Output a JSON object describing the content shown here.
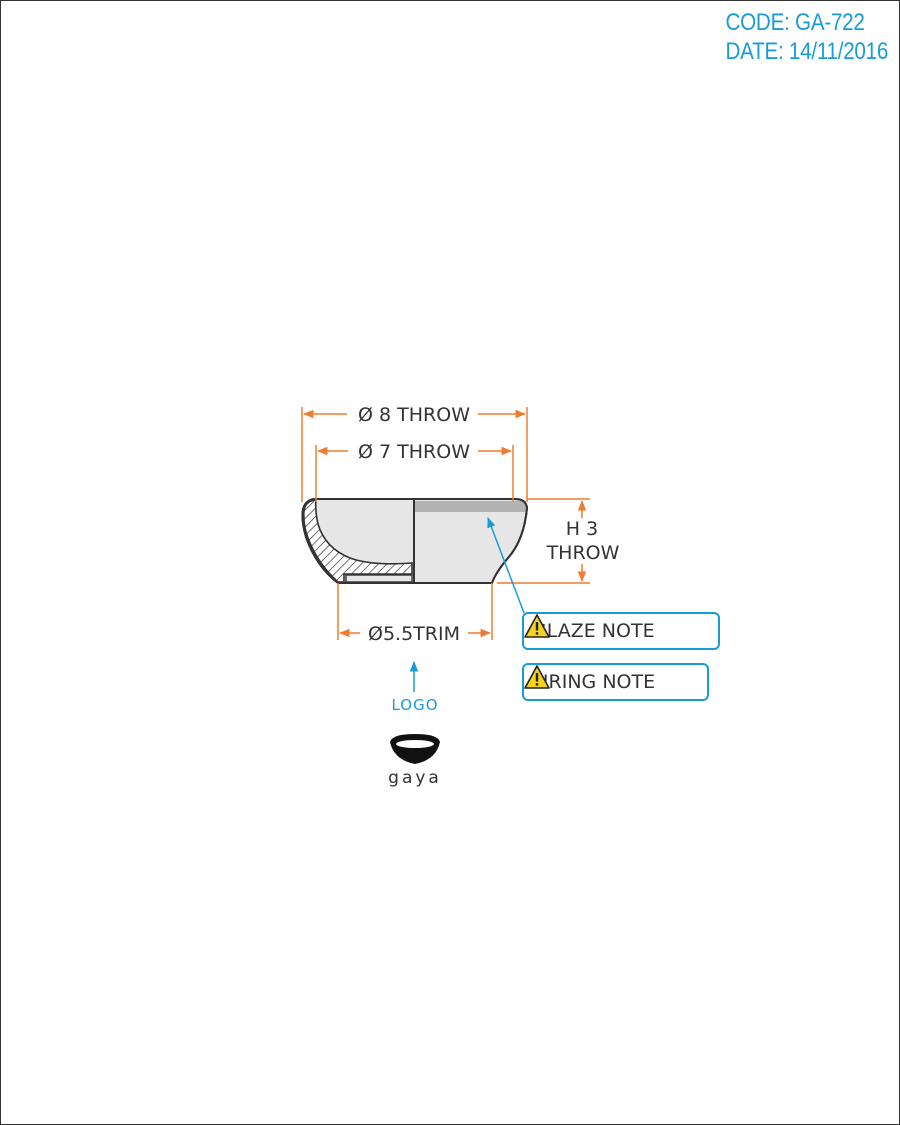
{
  "header": {
    "code": "CODE: GA-722",
    "date": "DATE: 14/11/2016"
  },
  "dimensions": {
    "outer_diameter": "Ø 8 THROW",
    "inner_diameter": "Ø 7 THROW",
    "height_line1": "H 3",
    "height_line2": "THROW",
    "foot_diameter": "Ø5.5TRIM"
  },
  "notes": [
    {
      "label": "GLAZE NOTE",
      "icon": "warning-icon"
    },
    {
      "label": "FIRING NOTE",
      "icon": "warning-icon"
    }
  ],
  "logo": {
    "label": "LOGO",
    "brand": "gaya",
    "icon": "bowl-logo-icon"
  },
  "colors": {
    "dimension": "#ee7d30",
    "annotation": "#1a9bd7",
    "outline": "#333333",
    "body_fill": "#e6e6e6",
    "glaze_band": "#b3b3b3",
    "warning": "#f6d21c"
  }
}
